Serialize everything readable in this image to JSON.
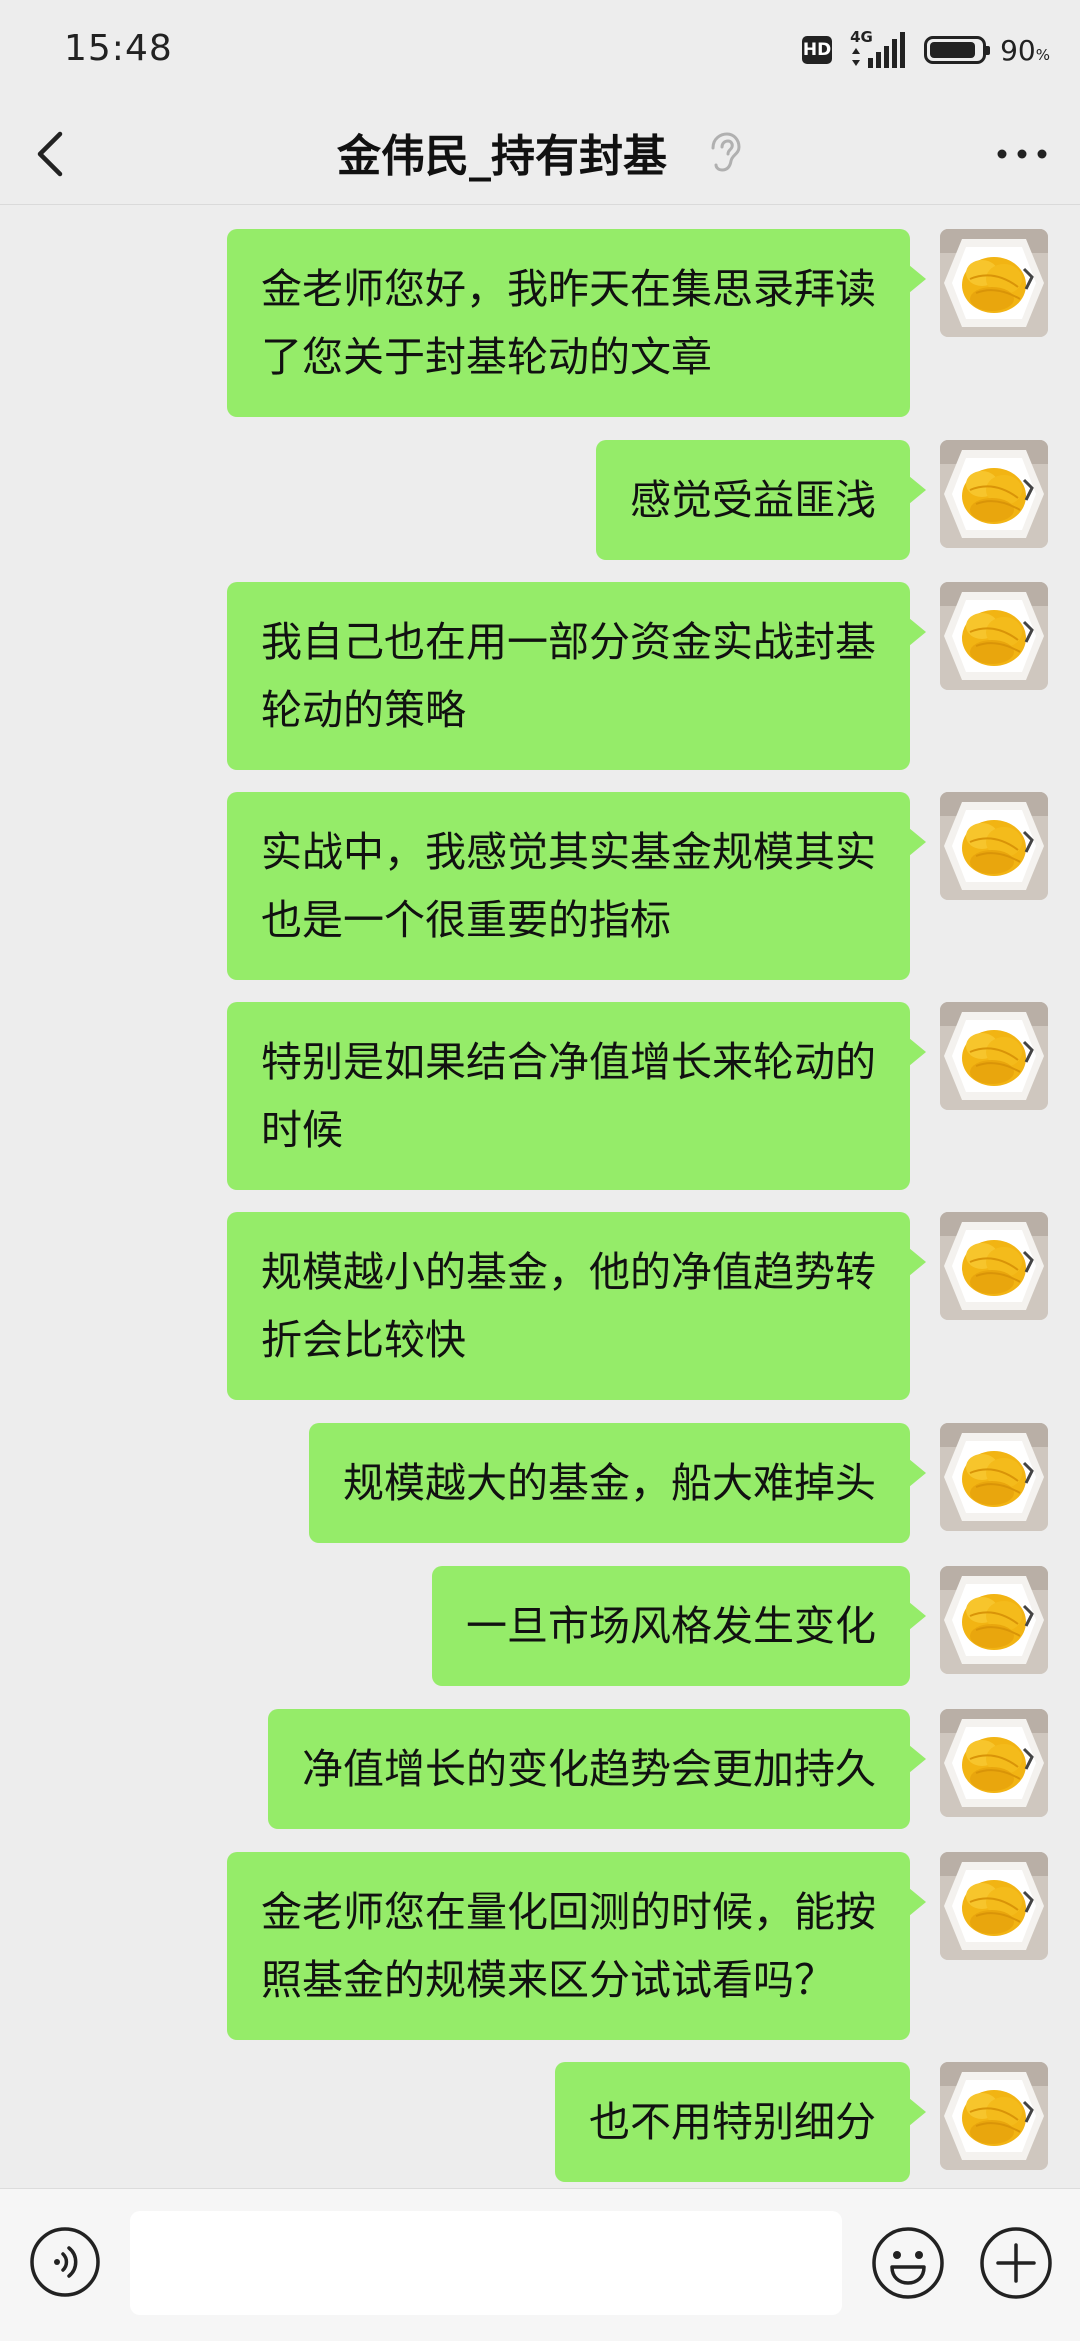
{
  "status_bar": {
    "time": "15:48",
    "hd": "HD",
    "network": "4G",
    "battery": "90",
    "battery_unit": "%",
    "battery_level": 0.9
  },
  "header": {
    "title": "金伟民_持有封基",
    "back_icon": "chevron-left-icon",
    "mode_icon": "ear-icon",
    "more_icon": "ellipsis-icon"
  },
  "messages": [
    {
      "sender": "me",
      "line1": "金老师您好，我昨天在集思录拜读",
      "line2": "了您关于封基轮动的文章"
    },
    {
      "sender": "me",
      "line1": "感觉受益匪浅",
      "line2": ""
    },
    {
      "sender": "me",
      "line1": "我自己也在用一部分资金实战封基",
      "line2": "轮动的策略"
    },
    {
      "sender": "me",
      "line1": "实战中，我感觉其实基金规模其实",
      "line2": "也是一个很重要的指标"
    },
    {
      "sender": "me",
      "line1": "特别是如果结合净值增长来轮动的",
      "line2": "时候"
    },
    {
      "sender": "me",
      "line1": "规模越小的基金，他的净值趋势转",
      "line2": "折会比较快"
    },
    {
      "sender": "me",
      "line1": "规模越大的基金，船大难掉头",
      "line2": ""
    },
    {
      "sender": "me",
      "line1": "一旦市场风格发生变化",
      "line2": ""
    },
    {
      "sender": "me",
      "line1": "净值增长的变化趋势会更加持久",
      "line2": ""
    },
    {
      "sender": "me",
      "line1": "金老师您在量化回测的时候，能按",
      "line2": "照基金的规模来区分试试看吗？"
    },
    {
      "sender": "me",
      "line1": "也不用特别细分",
      "line2": ""
    }
  ],
  "input_bar": {
    "voice_icon": "voice-icon",
    "input_value": "",
    "emoji_icon": "emoji-icon",
    "plus_icon": "plus-icon"
  },
  "colors": {
    "background": "#ededed",
    "bubble": "#95ec69",
    "input_bar": "#f6f6f6"
  }
}
